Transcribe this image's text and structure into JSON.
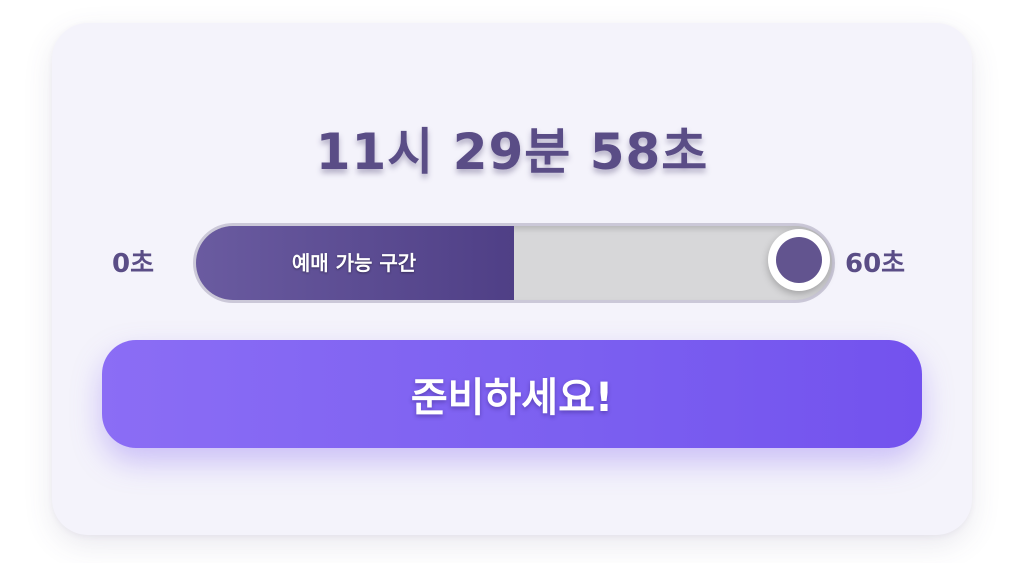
{
  "clock": {
    "time_text": "11시 29분 58초"
  },
  "slider": {
    "min_label": "0초",
    "max_label": "60초",
    "fill_label": "예매 가능 구간",
    "fill_fraction": 0.5,
    "value_fraction": 0.97
  },
  "action": {
    "button_label": "준비하세요!"
  },
  "colors": {
    "accent": "#7b5ff0",
    "text_primary": "#5a4d86",
    "fill": "#5a4b92",
    "track": "#d7d7d9"
  }
}
